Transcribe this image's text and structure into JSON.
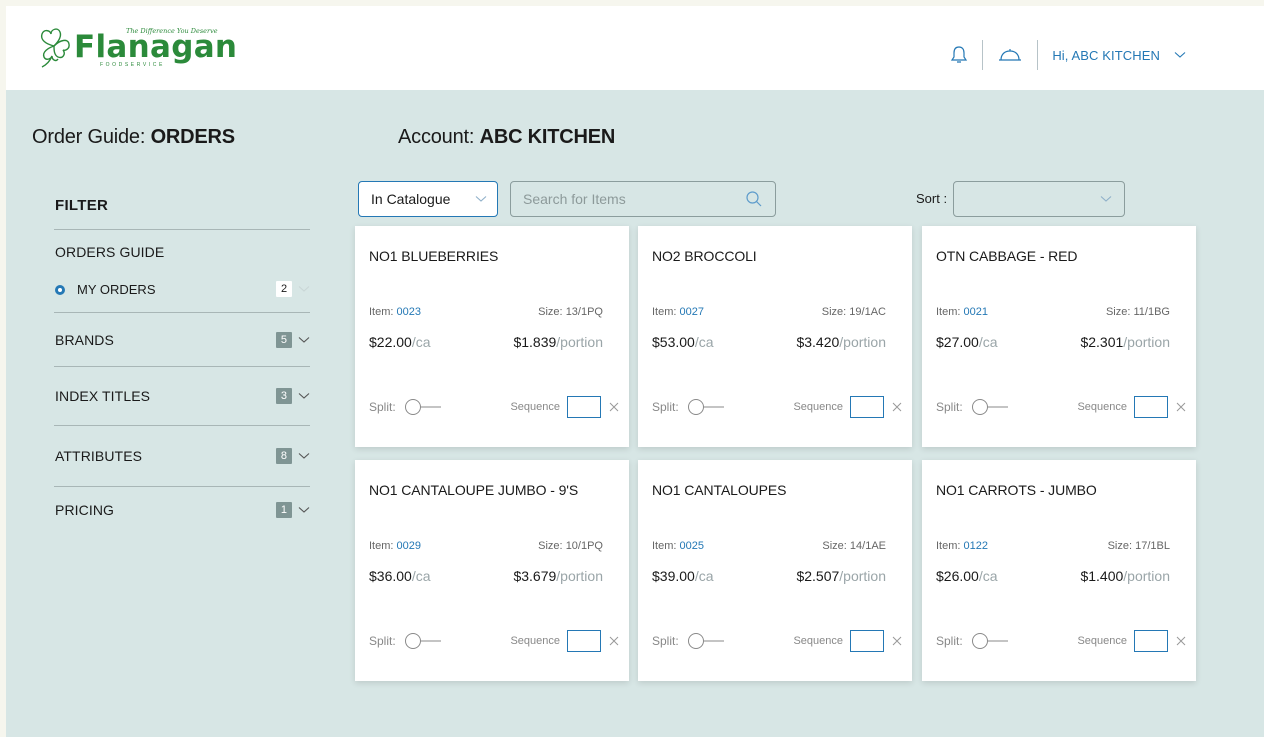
{
  "header": {
    "logo_name": "Flanagan",
    "logo_tagline": "The Difference You Deserve",
    "logo_sub": "FOODSERVICE",
    "greeting": "Hi, ABC KITCHEN",
    "icons": [
      "bell-icon",
      "cloche-icon",
      "chevron-down-icon"
    ],
    "accent_color": "#2478b5"
  },
  "titles": {
    "guide_label": "Order Guide:",
    "guide_value": "ORDERS",
    "account_label": "Account:",
    "account_value": "ABC KITCHEN"
  },
  "sidebar": {
    "filter_title": "FILTER",
    "orders_guide": {
      "label": "ORDERS GUIDE",
      "option_label": "MY ORDERS",
      "option_count": "2"
    },
    "sections": [
      {
        "label": "BRANDS",
        "count": "5"
      },
      {
        "label": "INDEX TITLES",
        "count": "3"
      },
      {
        "label": "ATTRIBUTES",
        "count": "8"
      },
      {
        "label": "PRICING",
        "count": "1"
      }
    ]
  },
  "toolbar": {
    "catalogue_select": "In Catalogue",
    "search_placeholder": "Search for Items",
    "sort_label": "Sort :",
    "sort_value": ""
  },
  "card_labels": {
    "item": "Item:",
    "size": "Size:",
    "per_case": "/ca",
    "per_portion": "/portion",
    "split": "Split:",
    "sequence": "Sequence"
  },
  "products": [
    {
      "name": "NO1 BLUEBERRIES",
      "item": "0023",
      "size": "13/1PQ",
      "price": "$22.00",
      "portion": "$1.839"
    },
    {
      "name": "NO2 BROCCOLI",
      "item": "0027",
      "size": "19/1AC",
      "price": "$53.00",
      "portion": "$3.420"
    },
    {
      "name": "OTN CABBAGE - RED",
      "item": "0021",
      "size": "11/1BG",
      "price": "$27.00",
      "portion": "$2.301"
    },
    {
      "name": "NO1 CANTALOUPE JUMBO - 9'S",
      "item": "0029",
      "size": "10/1PQ",
      "price": "$36.00",
      "portion": "$3.679"
    },
    {
      "name": "NO1 CANTALOUPES",
      "item": "0025",
      "size": "14/1AE",
      "price": "$39.00",
      "portion": "$2.507"
    },
    {
      "name": "NO1 CARROTS - JUMBO",
      "item": "0122",
      "size": "17/1BL",
      "price": "$26.00",
      "portion": "$1.400"
    }
  ]
}
